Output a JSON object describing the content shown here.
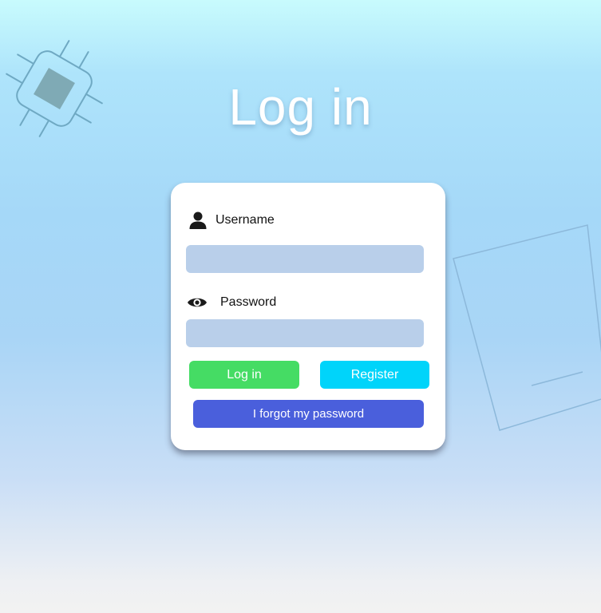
{
  "page": {
    "title": "Log in"
  },
  "form": {
    "username": {
      "label": "Username",
      "icon": "user-icon",
      "value": ""
    },
    "password": {
      "label": "Password",
      "icon": "eye-icon",
      "value": ""
    },
    "buttons": {
      "login_label": "Log in",
      "register_label": "Register",
      "forgot_label": "I forgot my password"
    }
  },
  "colors": {
    "login_button": "#45dc64",
    "register_button": "#00d4fa",
    "forgot_button": "#4a5fdc",
    "input_fill": "#b9cfea",
    "card": "#ffffff",
    "title_text": "#ffffff"
  },
  "decorations": {
    "top_left": "chip-icon",
    "right": "card-outline-decoration"
  }
}
